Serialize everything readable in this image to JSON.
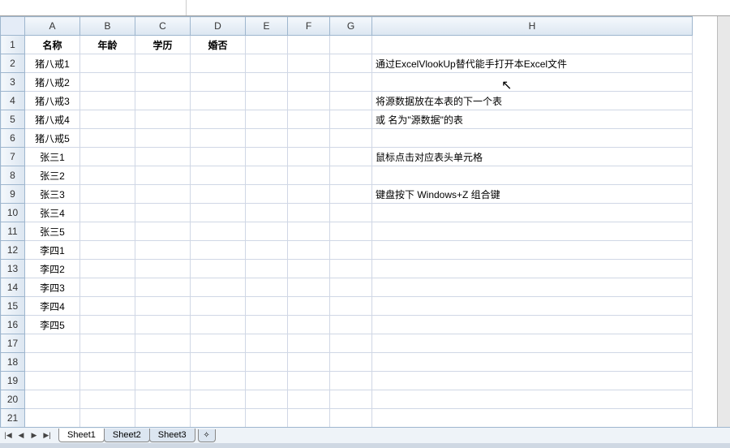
{
  "columns": [
    "A",
    "B",
    "C",
    "D",
    "E",
    "F",
    "G",
    "H"
  ],
  "rowCount": 22,
  "headers": {
    "A": "名称",
    "B": "年龄",
    "C": "学历",
    "D": "婚否"
  },
  "colA": [
    "猪八戒1",
    "猪八戒2",
    "猪八戒3",
    "猪八戒4",
    "猪八戒5",
    "张三1",
    "张三2",
    "张三3",
    "张三4",
    "张三5",
    "李四1",
    "李四2",
    "李四3",
    "李四4",
    "李四5"
  ],
  "colH": {
    "2": "通过ExcelVlookUp替代能手打开本Excel文件",
    "4": "将源数据放在本表的下一个表",
    "5": "或 名为\"源数据\"的表",
    "7": "鼠标点击对应表头单元格",
    "9": "键盘按下 Windows+Z 组合键"
  },
  "tabs": [
    "Sheet1",
    "Sheet2",
    "Sheet3"
  ],
  "activeTab": "Sheet1",
  "nav": {
    "first": "|◀",
    "prev": "◀",
    "next": "▶",
    "last": "▶|"
  },
  "newTabIcon": "✧"
}
